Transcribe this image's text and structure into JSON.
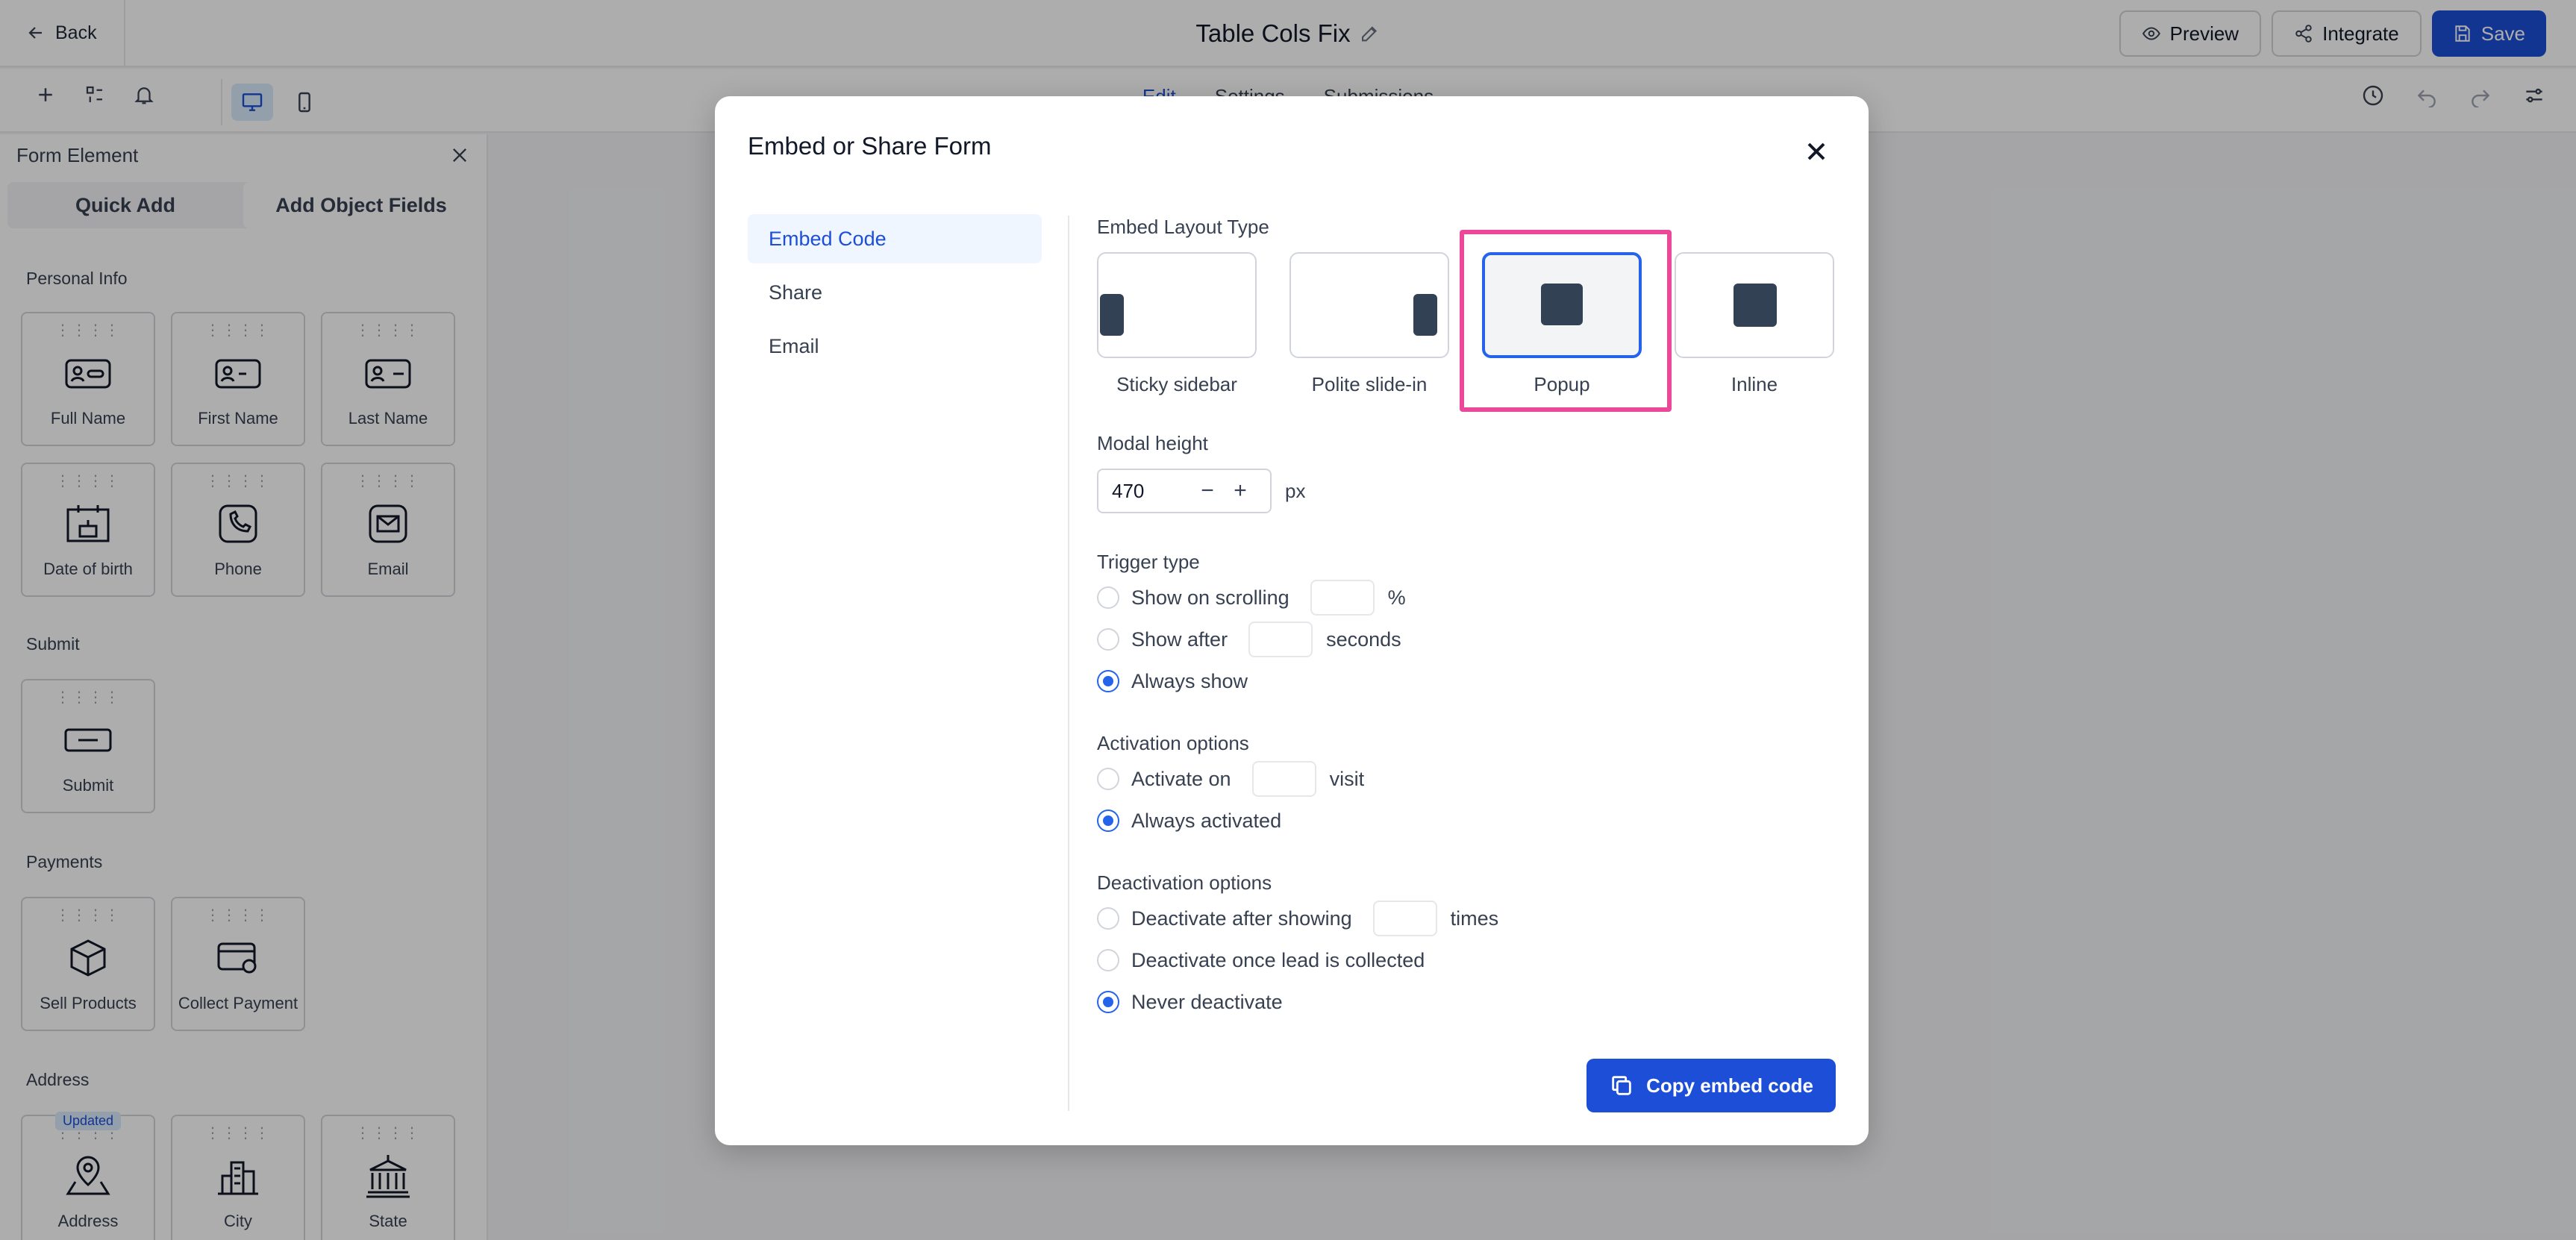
{
  "header": {
    "back_label": "Back",
    "title": "Table Cols Fix",
    "preview_label": "Preview",
    "integrate_label": "Integrate",
    "save_label": "Save"
  },
  "toolbar": {
    "tabs": [
      "Edit",
      "Settings",
      "Submissions"
    ],
    "active_tab": "Edit"
  },
  "left_panel": {
    "title": "Form Element",
    "tabs": [
      "Quick Add",
      "Add Object Fields"
    ],
    "sections": {
      "personal_info": "Personal Info",
      "submit": "Submit",
      "payments": "Payments",
      "address": "Address"
    },
    "tiles": {
      "full_name": "Full Name",
      "first_name": "First Name",
      "last_name": "Last Name",
      "date_of_birth": "Date of birth",
      "phone": "Phone",
      "email": "Email",
      "submit": "Submit",
      "sell_products": "Sell Products",
      "collect_payment": "Collect Payment",
      "address": "Address",
      "city": "City",
      "state": "State",
      "updated_badge": "Updated"
    }
  },
  "modal": {
    "title": "Embed or Share Form",
    "nav": [
      "Embed Code",
      "Share",
      "Email"
    ],
    "active_nav": "Embed Code",
    "embed_layout_label": "Embed Layout Type",
    "layouts": [
      "Sticky sidebar",
      "Polite slide-in",
      "Popup",
      "Inline"
    ],
    "selected_layout": "Popup",
    "modal_height_label": "Modal height",
    "modal_height_value": "470",
    "modal_height_unit": "px",
    "trigger_type_label": "Trigger type",
    "trigger": {
      "scrolling": "Show on scrolling",
      "scrolling_unit": "%",
      "after": "Show after",
      "after_unit": "seconds",
      "always": "Always show"
    },
    "activation_label": "Activation options",
    "activation": {
      "activate_on": "Activate on",
      "activate_unit": "visit",
      "always": "Always activated"
    },
    "deactivation_label": "Deactivation options",
    "deactivation": {
      "after_showing": "Deactivate after showing",
      "after_unit": "times",
      "once_lead": "Deactivate once lead is collected",
      "never": "Never deactivate"
    },
    "copy_button": "Copy embed code"
  },
  "colors": {
    "primary": "#1d4ed8",
    "highlight": "#ec4899",
    "card_shape": "#334155"
  }
}
